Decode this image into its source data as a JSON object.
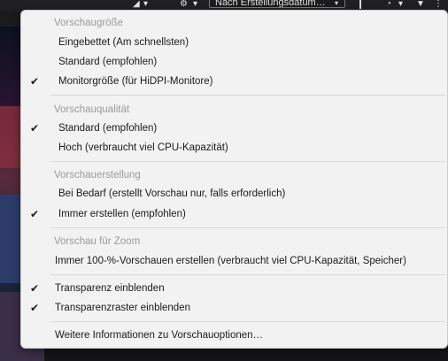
{
  "app": {
    "sort_field": "Nach Erstellungsdatum…",
    "colors": {
      "menu_bg": "#f2f2f2",
      "header_text": "#9a9a9a",
      "item_text": "#1a1a1a",
      "separator": "#d6d6d6"
    }
  },
  "menu": {
    "sections": {
      "size": {
        "header": "Vorschaugröße",
        "items": [
          {
            "label": "Eingebettet  (Am schnellsten)",
            "checked": false
          },
          {
            "label": "Standard (empfohlen)",
            "checked": false
          },
          {
            "label": "Monitorgröße (für HiDPI-Monitore)",
            "checked": true
          }
        ]
      },
      "quality": {
        "header": "Vorschauqualität",
        "items": [
          {
            "label": "Standard (empfohlen)",
            "checked": true
          },
          {
            "label": "Hoch (verbraucht viel CPU-Kapazität)",
            "checked": false
          }
        ]
      },
      "creation": {
        "header": "Vorschauerstellung",
        "items": [
          {
            "label": "Bei Bedarf (erstellt Vorschau nur, falls erforderlich)",
            "checked": false
          },
          {
            "label": "Immer erstellen  (empfohlen)",
            "checked": true
          }
        ]
      },
      "zoom": {
        "header": "Vorschau für Zoom",
        "items": [
          {
            "label": "Immer 100-%-Vorschauen erstellen (verbraucht viel CPU-Kapazität, Speicher)",
            "checked": false
          }
        ]
      },
      "transparency": {
        "items": [
          {
            "label": "Transparenz einblenden",
            "checked": true
          },
          {
            "label": "Transparenzraster einblenden",
            "checked": true
          }
        ]
      },
      "more": {
        "items": [
          {
            "label": "Weitere Informationen zu Vorschauoptionen…",
            "checked": false
          }
        ]
      }
    },
    "check_glyph": "✔",
    "icon_names": [
      "checkmark-icon",
      "chevron-down-icon",
      "gear-icon"
    ]
  }
}
